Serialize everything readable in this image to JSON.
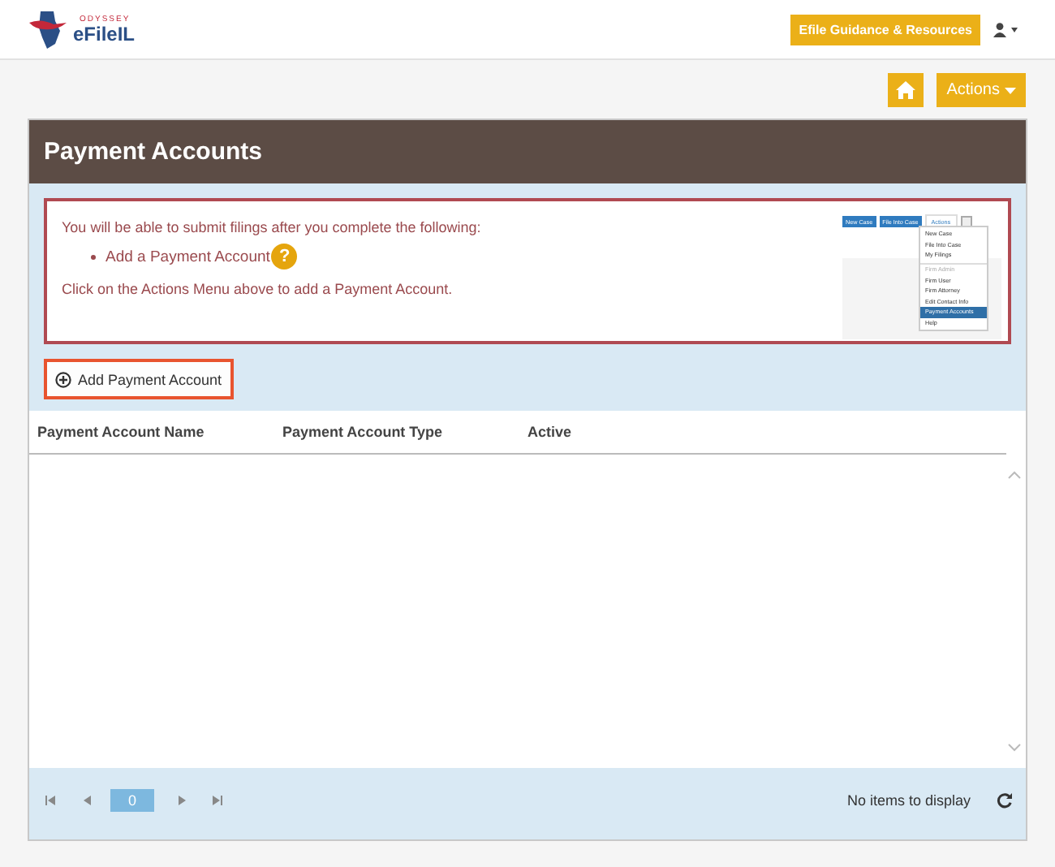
{
  "header": {
    "logo_small": "ODYSSEY",
    "logo": "eFileIL",
    "guidance_button": "Efile Guidance & Resources"
  },
  "toolbar": {
    "actions_button": "Actions"
  },
  "panel": {
    "title": "Payment Accounts",
    "notice": {
      "intro": "You will be able to submit filings after you complete the following:",
      "items": [
        {
          "label": "Add a Payment Account",
          "help": "?"
        }
      ],
      "outro": "Click on the Actions Menu above to add a Payment Account.",
      "preview": {
        "buttons": [
          "New Case",
          "File Into Case"
        ],
        "menu_button": "Actions",
        "menu_items": [
          {
            "label": "New Case",
            "kind": "item",
            "selected": false
          },
          {
            "label": "File Into Case",
            "kind": "item",
            "selected": false
          },
          {
            "label": "My Filings",
            "kind": "item",
            "selected": false
          },
          {
            "label": "Firm Admin",
            "kind": "header",
            "selected": false
          },
          {
            "label": "Firm User",
            "kind": "item",
            "selected": false
          },
          {
            "label": "Firm Attorney",
            "kind": "item",
            "selected": false
          },
          {
            "label": "Edit Contact Info",
            "kind": "item",
            "selected": false
          },
          {
            "label": "Payment Accounts",
            "kind": "item",
            "selected": true
          },
          {
            "label": "Help",
            "kind": "item",
            "selected": false
          }
        ]
      }
    },
    "add_button": "Add Payment Account",
    "table": {
      "columns": [
        "Payment Account Name",
        "Payment Account Type",
        "Active"
      ]
    },
    "pager": {
      "page": "0",
      "status": "No items to display"
    }
  }
}
